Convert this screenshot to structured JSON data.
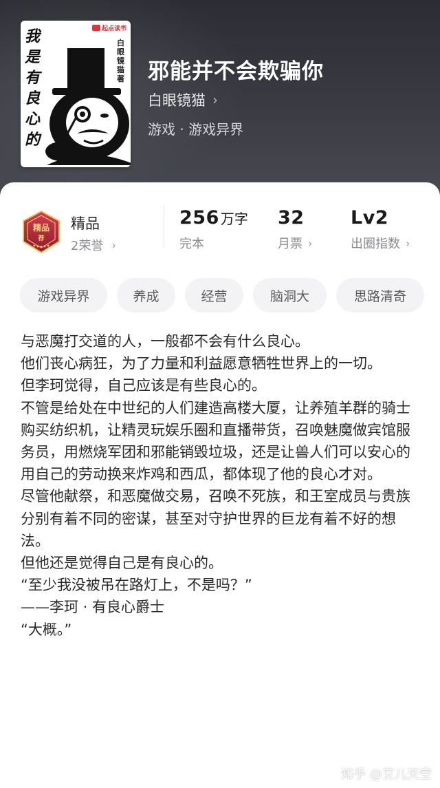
{
  "book": {
    "title": "邪能并不会欺骗你",
    "author": "白眼镜猫",
    "author_chevron": "›",
    "genre": "游戏 · 游戏异界"
  },
  "cover": {
    "title_lines": [
      "我",
      "是",
      "有",
      "良",
      "心",
      "的"
    ],
    "author_vertical": "白眼镜猫著",
    "publisher": "起点读书"
  },
  "stats": {
    "tier_label": "精品",
    "honors": "2荣誉",
    "word_count": "256",
    "word_unit": "万字",
    "word_status": "完本",
    "tickets": "32",
    "tickets_label": "月票",
    "level": "Lv2",
    "level_label": "出圈指数",
    "chevron": "›"
  },
  "tags": [
    "游戏异界",
    "养成",
    "经营",
    "脑洞大",
    "思路清奇"
  ],
  "synopsis": [
    "与恶魔打交道的人，一般都不会有什么良心。",
    "他们丧心病狂，为了力量和利益愿意牺牲世界上的一切。",
    "但李珂觉得，自己应该是有些良心的。",
    "不管是给处在中世纪的人们建造高楼大厦，让养殖羊群的骑士购买纺织机，让精灵玩娱乐圈和直播带货，召唤魅魔做宾馆服务员，用燃烧军团和邪能销毁垃圾，还是让兽人们可以安心的用自己的劳动换来炸鸡和西瓜，都体现了他的良心才对。",
    "尽管他献祭，和恶魔做交易，召唤不死族，和王室成员与贵族分别有着不同的密谋，甚至对守护世界的巨龙有着不好的想法。",
    "但他还是觉得自己是有良心的。",
    "“至少我没被吊在路灯上，不是吗？”",
    "——李珂 · 有良心爵士",
    "“大概。”"
  ],
  "watermark": "知乎 @艾儿天空",
  "colors": {
    "hero_bg": "#3b3c44",
    "medal_red": "#b8283a",
    "medal_gold": "#f3c15a",
    "tag_bg": "#f3f3f5"
  },
  "icons": {
    "medal": "premium-medal-icon",
    "chevron": "chevron-right-icon"
  }
}
